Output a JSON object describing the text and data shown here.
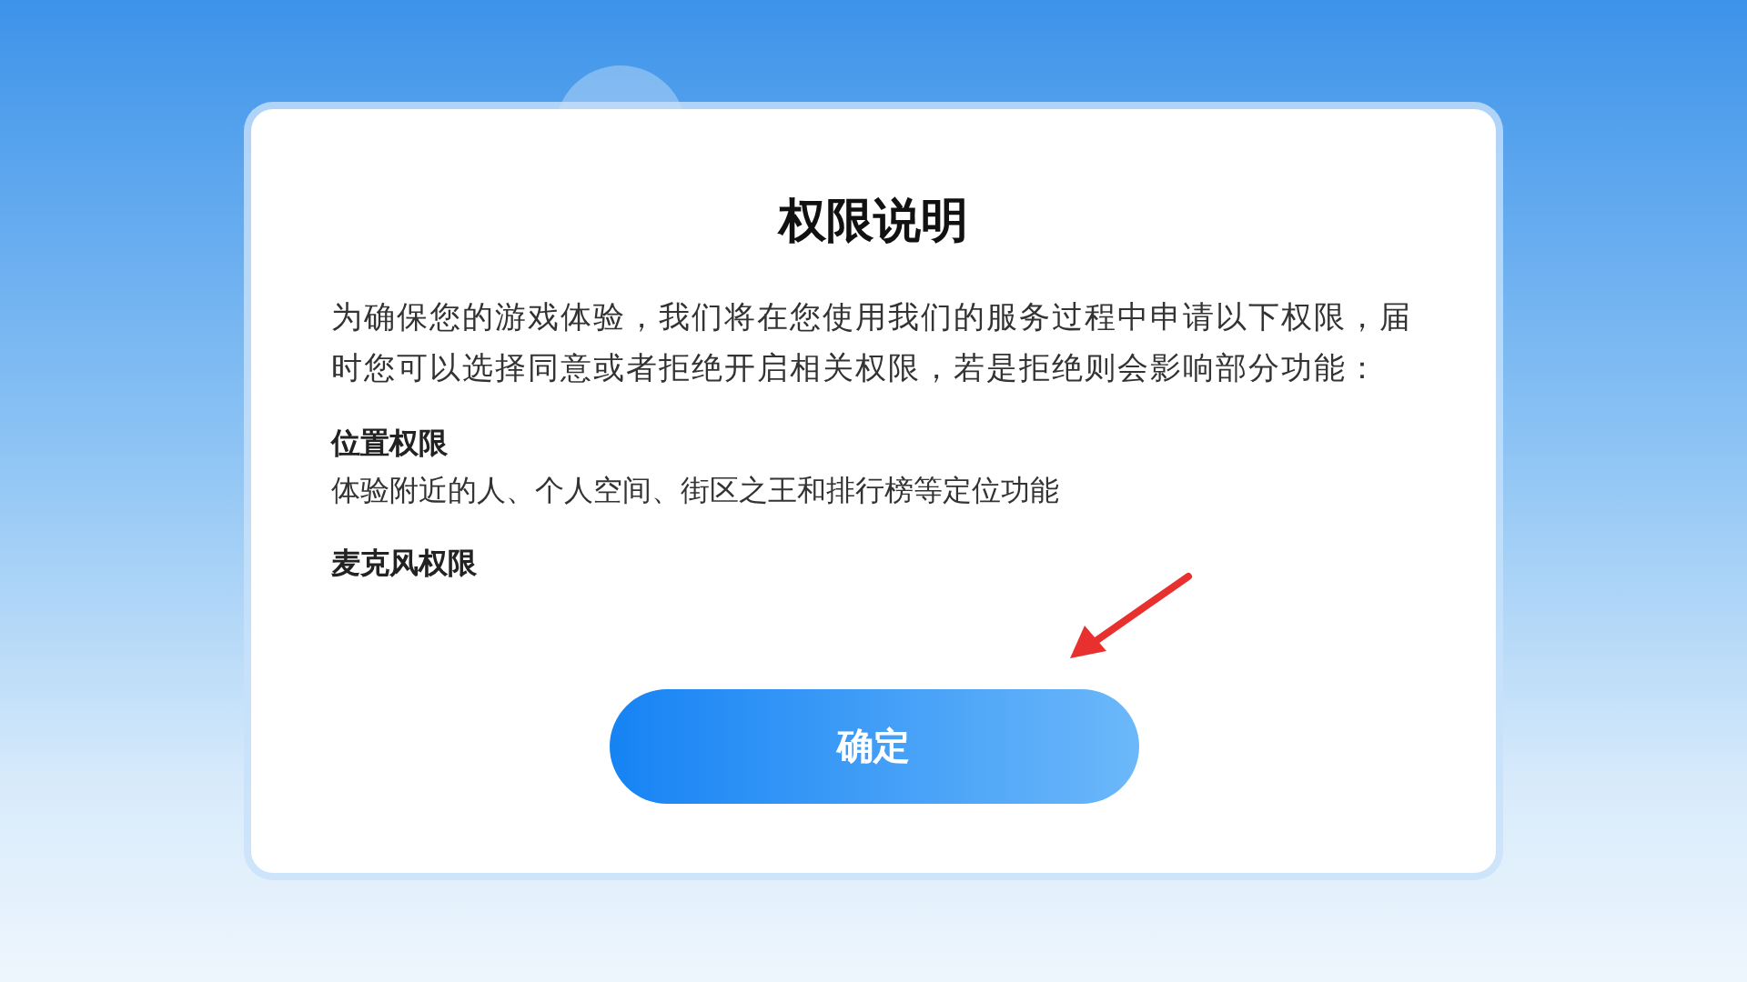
{
  "dialog": {
    "title": "权限说明",
    "intro": "为确保您的游戏体验，我们将在您使用我们的服务过程中申请以下权限，届时您可以选择同意或者拒绝开启相关权限，若是拒绝则会影响部分功能：",
    "permissions": [
      {
        "name": "位置权限",
        "description": "体验附近的人、个人空间、街区之王和排行榜等定位功能"
      },
      {
        "name": "麦克风权限"
      }
    ],
    "button": "确定"
  }
}
